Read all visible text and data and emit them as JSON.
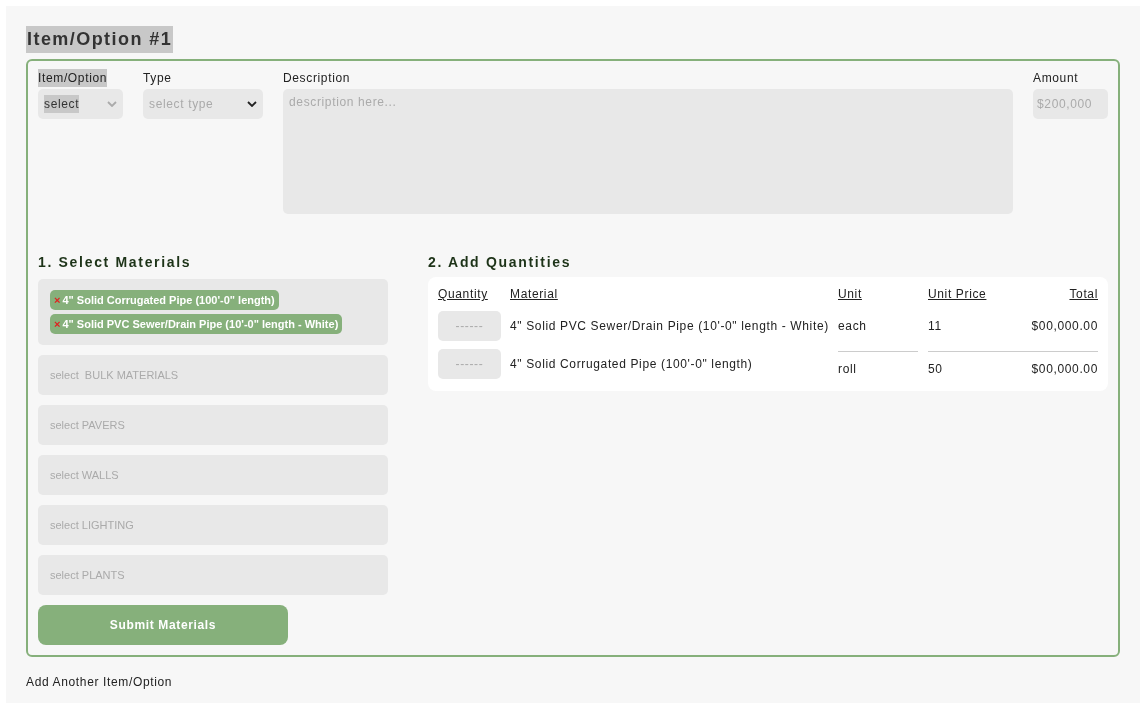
{
  "title": "Item/Option #1",
  "fields": {
    "item_option": {
      "label": "Item/Option",
      "value": "select"
    },
    "type": {
      "label": "Type",
      "value": "select type"
    },
    "description": {
      "label": "Description",
      "placeholder": "description here..."
    },
    "amount": {
      "label": "Amount",
      "placeholder": "$200,000"
    }
  },
  "materials": {
    "heading": "1. Select Materials",
    "selected": [
      {
        "remove": "×",
        "label": "4\" Solid Corrugated Pipe (100'-0\" length)"
      },
      {
        "remove": "×",
        "label": "4\" Solid PVC Sewer/Drain Pipe (10'-0\" length - White)"
      }
    ],
    "selects": [
      "select  BULK MATERIALS",
      "select PAVERS",
      "select WALLS",
      "select LIGHTING",
      "select PLANTS"
    ],
    "submit": "Submit Materials"
  },
  "quantities": {
    "heading": "2. Add Quantities",
    "columns": [
      "Quantity",
      "Material",
      "Unit",
      "Unit Price",
      "Total"
    ],
    "rows": [
      {
        "quantity_placeholder": "------",
        "material": "4\" Solid PVC Sewer/Drain Pipe (10'-0\" length - White)",
        "unit": "each",
        "unit_price": "11",
        "total": "$00,000.00"
      },
      {
        "quantity_placeholder": "------",
        "material": "4\" Solid Corrugated Pipe (100'-0\" length)",
        "unit": "roll",
        "unit_price": "50",
        "total": "$00,000.00"
      }
    ]
  },
  "add_link": "Add Another Item/Option"
}
